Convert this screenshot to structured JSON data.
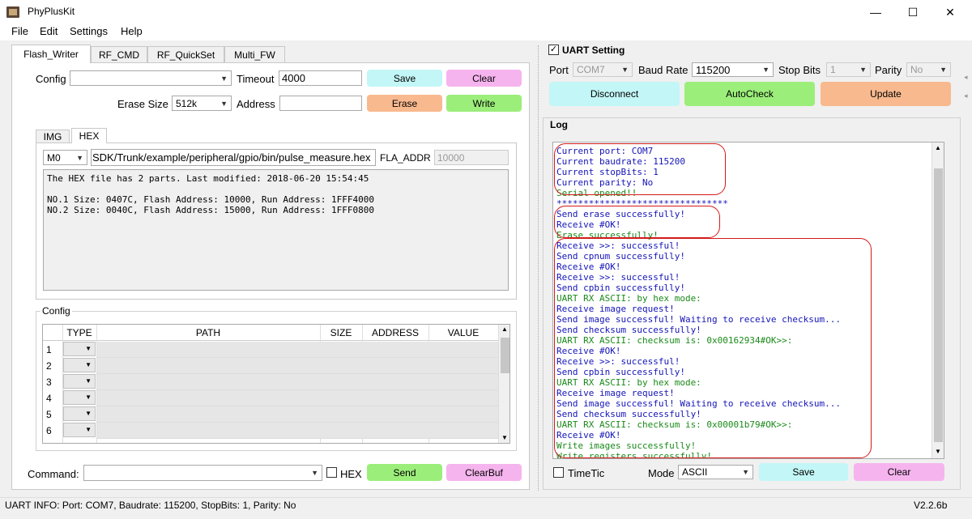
{
  "window": {
    "title": "PhyPlusKit",
    "minimize": "—",
    "maximize": "☐",
    "close": "✕"
  },
  "menu": [
    "File",
    "Edit",
    "Settings",
    "Help"
  ],
  "tabs": [
    "Flash_Writer",
    "RF_CMD",
    "RF_QuickSet",
    "Multi_FW"
  ],
  "flash": {
    "config_label": "Config",
    "config_value": "",
    "timeout_label": "Timeout",
    "timeout_value": "4000",
    "save": "Save",
    "clear": "Clear",
    "erase_size_label": "Erase Size",
    "erase_size_value": "512k",
    "address_label": "Address",
    "address_value": "",
    "erase": "Erase",
    "write": "Write"
  },
  "subtabs": [
    "IMG",
    "HEX"
  ],
  "hex": {
    "mode": "M0",
    "path": "SDK/Trunk/example/peripheral/gpio/bin/pulse_measure.hex",
    "fla_label": "FLA_ADDR",
    "fla_value": "10000",
    "info": [
      "The HEX file has 2 parts. Last modified: 2018-06-20 15:54:45",
      "",
      "NO.1   Size: 0407C, Flash Address: 10000, Run Address: 1FFF4000",
      "NO.2   Size: 0040C, Flash Address: 15000, Run Address: 1FFF0800"
    ]
  },
  "config_group": {
    "label": "Config",
    "columns": [
      "TYPE",
      "PATH",
      "SIZE",
      "ADDRESS",
      "VALUE"
    ],
    "rows": [
      "1",
      "2",
      "3",
      "4",
      "5",
      "6"
    ]
  },
  "command": {
    "label": "Command:",
    "value": "",
    "hex_label": "HEX",
    "send": "Send",
    "clearbuf": "ClearBuf"
  },
  "uart": {
    "title": "UART Setting",
    "port_label": "Port",
    "port_value": "COM7",
    "baud_label": "Baud Rate",
    "baud_value": "115200",
    "stop_label": "Stop Bits",
    "stop_value": "1",
    "parity_label": "Parity",
    "parity_value": "No",
    "disconnect": "Disconnect",
    "autocheck": "AutoCheck",
    "update": "Update"
  },
  "log": {
    "title": "Log",
    "lines": [
      {
        "t": "Current port: COM7",
        "c": "#1414b8"
      },
      {
        "t": "Current baudrate: 115200",
        "c": "#1414b8"
      },
      {
        "t": "Current stopBits: 1",
        "c": "#1414b8"
      },
      {
        "t": "Current parity: No",
        "c": "#1414b8"
      },
      {
        "t": "Serial opened!!",
        "c": "#1a8a1a"
      },
      {
        "t": "********************************",
        "c": "#1414b8"
      },
      {
        "t": "Send erase successfully!",
        "c": "#1414b8"
      },
      {
        "t": "Receive #OK!",
        "c": "#1414b8"
      },
      {
        "t": "Erase successfully!",
        "c": "#1a8a1a"
      },
      {
        "t": "Receive >>: successful!",
        "c": "#1414b8"
      },
      {
        "t": "Send cpnum successfully!",
        "c": "#1414b8"
      },
      {
        "t": "Receive #OK!",
        "c": "#1414b8"
      },
      {
        "t": "Receive >>: successful!",
        "c": "#1414b8"
      },
      {
        "t": "Send cpbin successfully!",
        "c": "#1414b8"
      },
      {
        "t": "UART RX ASCII: by hex mode:",
        "c": "#1a8a1a"
      },
      {
        "t": "Receive image request!",
        "c": "#1414b8"
      },
      {
        "t": "Send image successful! Waiting to receive checksum...",
        "c": "#1414b8"
      },
      {
        "t": "Send checksum successfully!",
        "c": "#1414b8"
      },
      {
        "t": "UART RX ASCII: checksum is: 0x00162934#OK>>:",
        "c": "#1a8a1a"
      },
      {
        "t": "Receive #OK!",
        "c": "#1414b8"
      },
      {
        "t": "Receive >>: successful!",
        "c": "#1414b8"
      },
      {
        "t": "Send cpbin successfully!",
        "c": "#1414b8"
      },
      {
        "t": "UART RX ASCII: by hex mode:",
        "c": "#1a8a1a"
      },
      {
        "t": "Receive image request!",
        "c": "#1414b8"
      },
      {
        "t": "Send image successful! Waiting to receive checksum...",
        "c": "#1414b8"
      },
      {
        "t": "Send checksum successfully!",
        "c": "#1414b8"
      },
      {
        "t": "UART RX ASCII: checksum is: 0x00001b79#OK>>:",
        "c": "#1a8a1a"
      },
      {
        "t": "Receive #OK!",
        "c": "#1414b8"
      },
      {
        "t": "Write images successfully!",
        "c": "#1a8a1a"
      },
      {
        "t": "Write registers successfully!",
        "c": "#1a8a1a"
      }
    ],
    "timetic": "TimeTic",
    "mode_label": "Mode",
    "mode_value": "ASCII",
    "save": "Save",
    "clear": "Clear"
  },
  "status": {
    "info": "UART INFO:  Port: COM7, Baudrate: 115200, StopBits: 1, Parity: No",
    "version": "V2.2.6b"
  }
}
